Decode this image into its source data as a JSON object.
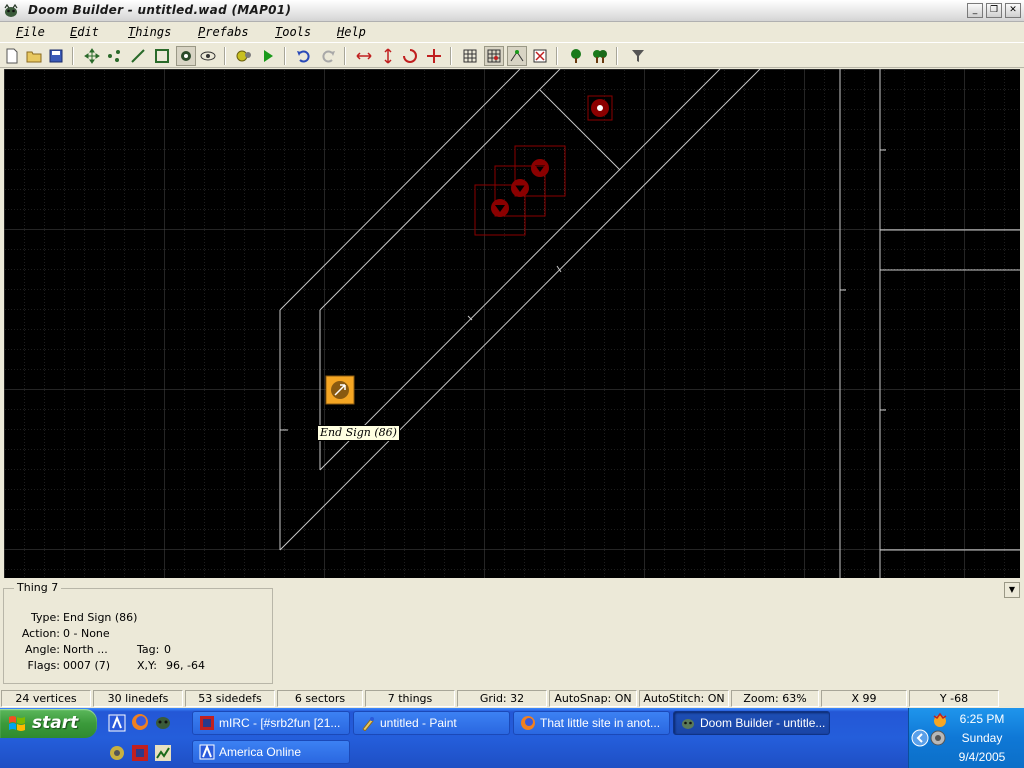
{
  "window": {
    "title": "Doom Builder - untitled.wad (MAP01)",
    "minimize": "_",
    "restore": "❐",
    "close": "✕"
  },
  "menu": [
    "File",
    "Edit",
    "Things",
    "Prefabs",
    "Tools",
    "Help"
  ],
  "toolbar": {
    "buttons": [
      {
        "name": "new-map-icon"
      },
      {
        "name": "open-map-icon"
      },
      {
        "name": "save-map-icon"
      },
      {
        "name": "move-mode-icon"
      },
      {
        "name": "vertices-mode-icon"
      },
      {
        "name": "linedefs-mode-icon"
      },
      {
        "name": "sectors-mode-icon"
      },
      {
        "name": "things-mode-icon"
      },
      {
        "name": "3d-mode-icon"
      },
      {
        "name": "build-nodes-icon"
      },
      {
        "name": "test-map-icon"
      },
      {
        "name": "undo-icon"
      },
      {
        "name": "redo-icon"
      },
      {
        "name": "flip-horizontal-icon"
      },
      {
        "name": "flip-vertical-icon"
      },
      {
        "name": "rotate-icon"
      },
      {
        "name": "resize-icon"
      },
      {
        "name": "show-grid-icon"
      },
      {
        "name": "snap-to-grid-icon"
      },
      {
        "name": "stitch-vertices-icon"
      },
      {
        "name": "delete-icon"
      },
      {
        "name": "prefab-tree-icon"
      },
      {
        "name": "prefab-trees-icon"
      },
      {
        "name": "filter-icon"
      }
    ]
  },
  "map": {
    "background": "#000000",
    "grid_color": "#3a3a3a",
    "line_color": "#c8c8c8",
    "thing_color": "#8b0000",
    "selected_thing_color": "#f5a623",
    "tooltip": "End Sign (86)"
  },
  "info": {
    "heading": "Thing 7",
    "type_label": "Type:",
    "type_value": "End Sign (86)",
    "action_label": "Action:",
    "action_value": "0 - None",
    "angle_label": "Angle:",
    "angle_value": "North ...",
    "tag_label": "Tag:",
    "tag_value": "0",
    "flags_label": "Flags:",
    "flags_value": "0007 (7)",
    "xy_label": "X,Y:",
    "xy_value": "96, -64"
  },
  "status": {
    "vertices": "24 vertices",
    "linedefs": "30 linedefs",
    "sidedefs": "53 sidedefs",
    "sectors": "6 sectors",
    "things": "7 things",
    "grid": "Grid: 32",
    "autosnap": "AutoSnap: ON",
    "autostitch": "AutoStitch: ON",
    "zoom": "Zoom: 63%",
    "x": "X 99",
    "y": "Y -68"
  },
  "taskbar": {
    "start_label": "start",
    "tasks": [
      {
        "label": "mIRC - [#srb2fun [21...",
        "icon": "mirc-icon"
      },
      {
        "label": "untitled - Paint",
        "icon": "paint-icon"
      },
      {
        "label": "That little site in anot...",
        "icon": "firefox-icon"
      },
      {
        "label": "Doom Builder - untitle...",
        "icon": "doom-builder-icon"
      },
      {
        "label": "America Online",
        "icon": "aol-icon"
      }
    ],
    "clock_time": "6:25 PM",
    "clock_day": "Sunday",
    "clock_date": "9/4/2005"
  }
}
